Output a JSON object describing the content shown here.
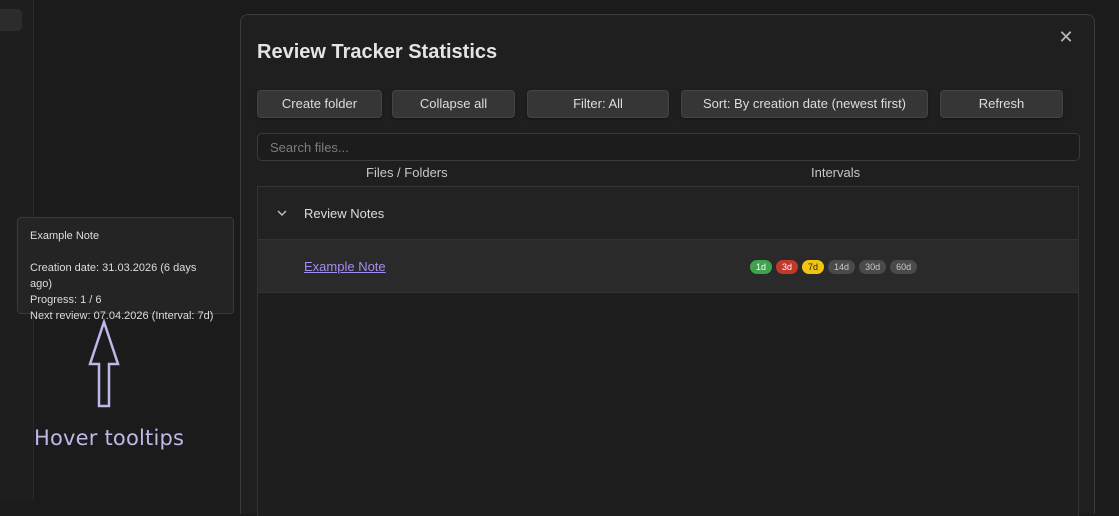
{
  "tooltip": {
    "title": "Example Note",
    "creation": "Creation date: 31.03.2026 (6 days ago)",
    "progress": "Progress: 1 / 6",
    "next_review": "Next review: 07.04.2026 (Interval: 7d)"
  },
  "caption": "Hover tooltips",
  "modal": {
    "title": "Review Tracker Statistics",
    "close_icon": "close-icon"
  },
  "toolbar": {
    "create_folder": "Create folder",
    "collapse_all": "Collapse all",
    "filter": "Filter: All",
    "sort": "Sort: By creation date (newest first)",
    "refresh": "Refresh"
  },
  "search": {
    "placeholder": "Search files..."
  },
  "columns": {
    "files": "Files / Folders",
    "intervals": "Intervals"
  },
  "folder": {
    "name": "Review Notes",
    "icon": "chevron-down-icon"
  },
  "file": {
    "name": "Example Note",
    "intervals": [
      {
        "label": "1d",
        "color": "#3fa34d"
      },
      {
        "label": "3d",
        "color": "#c0392b"
      },
      {
        "label": "7d",
        "color": "#f1c40f"
      },
      {
        "label": "14d",
        "color": "#4a4a4a"
      },
      {
        "label": "30d",
        "color": "#4a4a4a"
      },
      {
        "label": "60d",
        "color": "#4a4a4a"
      }
    ]
  }
}
